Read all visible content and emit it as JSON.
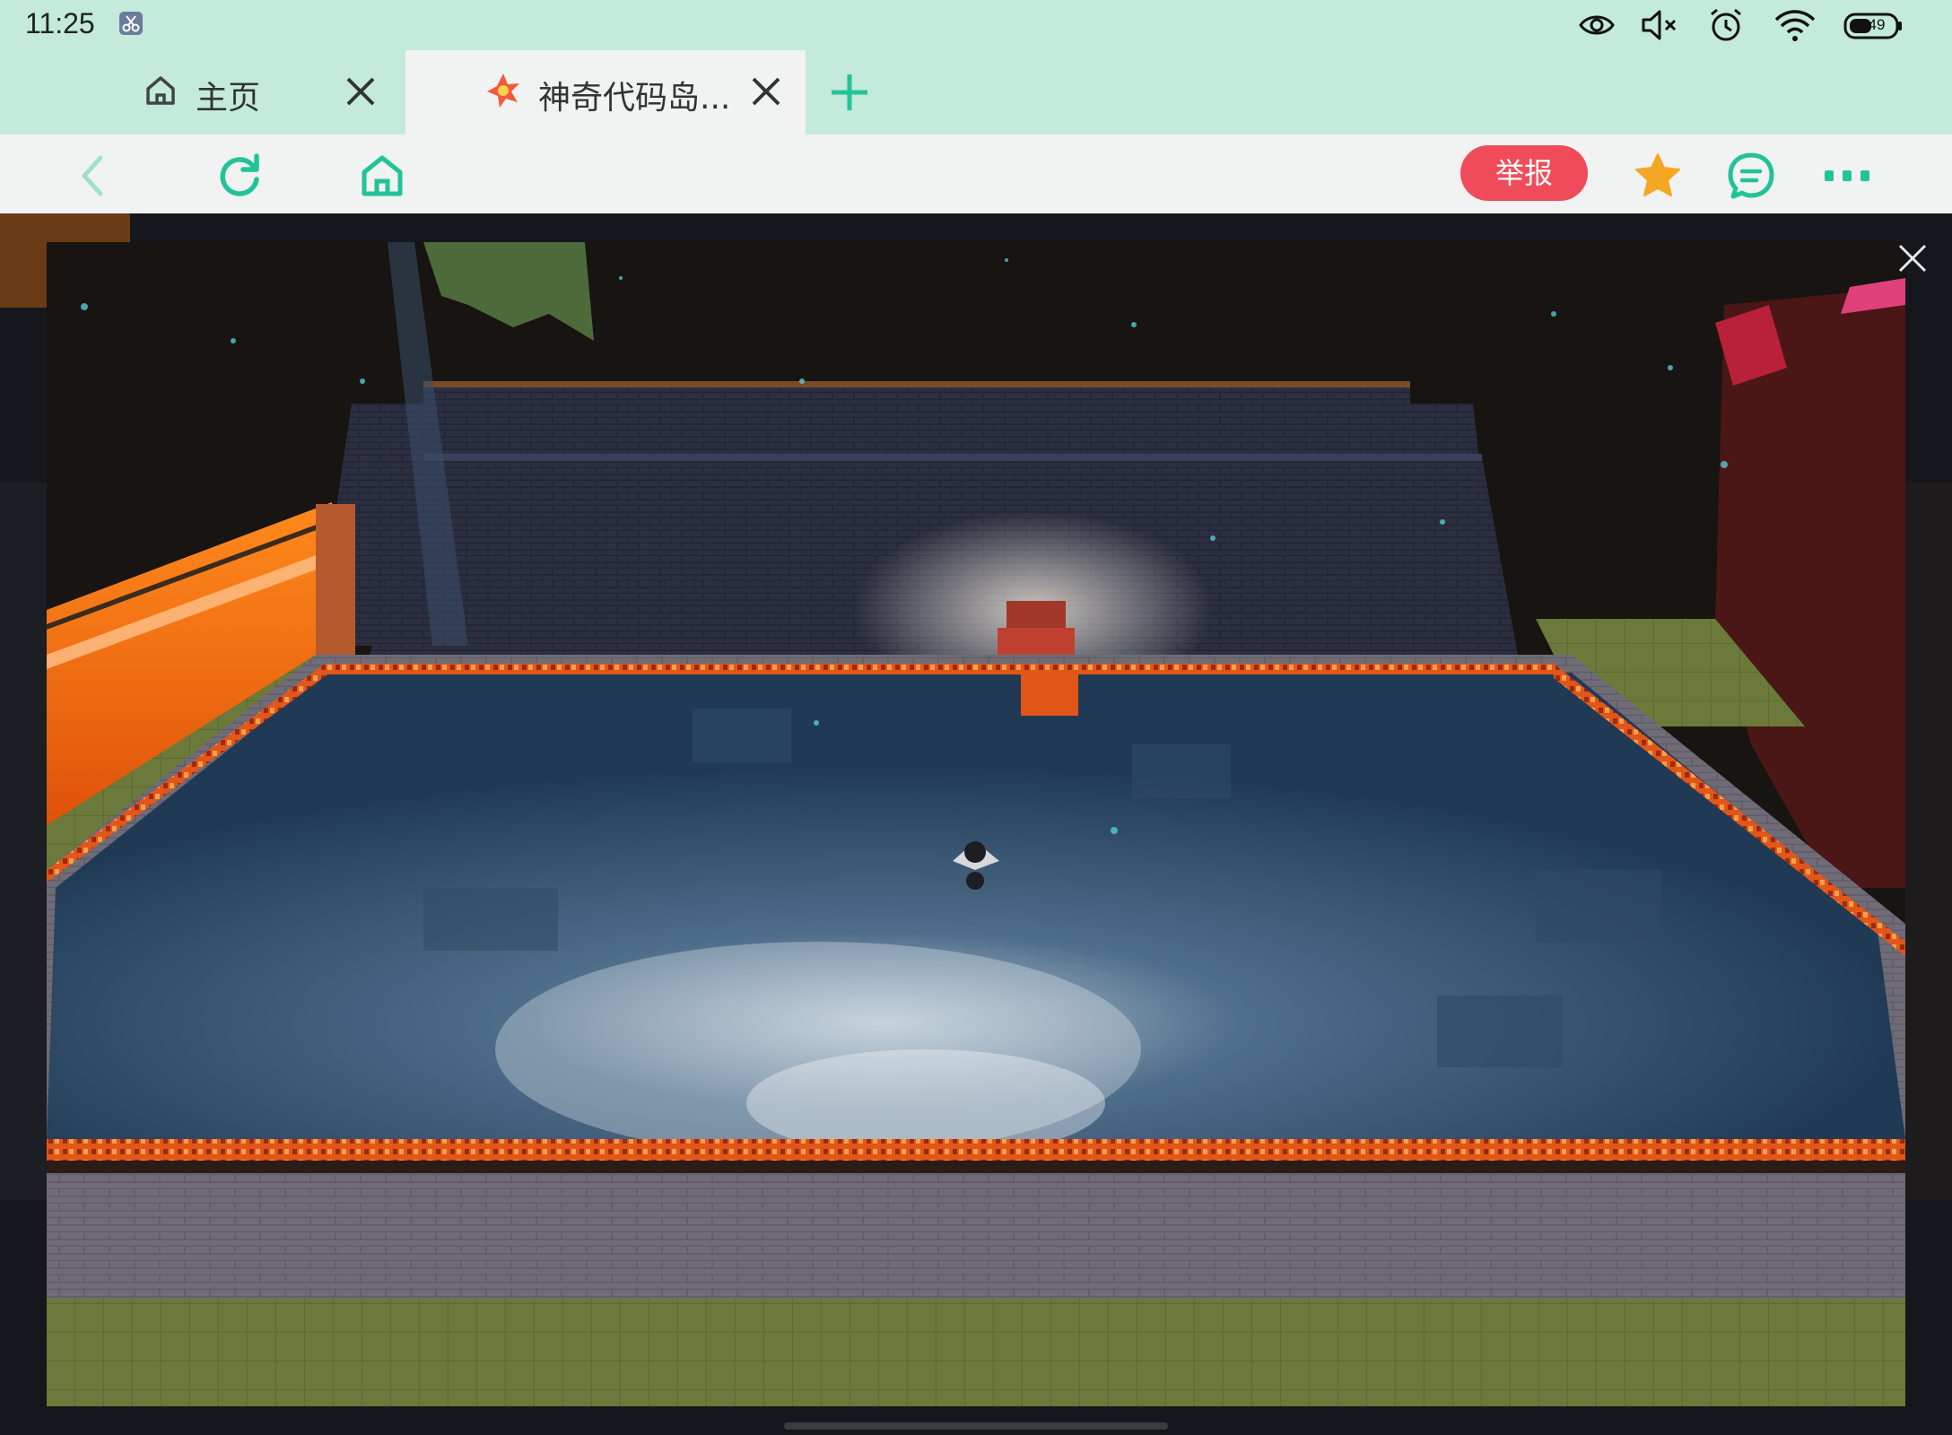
{
  "status_bar": {
    "time": "11:25",
    "clip_icon": "scissors-icon",
    "icons": [
      "eye-icon",
      "mute-icon",
      "alarm-icon",
      "wifi-icon",
      "battery-icon"
    ],
    "battery_level": "49"
  },
  "tabs": [
    {
      "title": "主页",
      "icon": "home-icon",
      "active": false
    },
    {
      "title": "神奇代码岛...",
      "icon": "codeisland-logo-icon",
      "active": true
    }
  ],
  "new_tab_icon": "plus-icon",
  "toolbar": {
    "back_icon": "back-arrow-icon",
    "refresh_icon": "refresh-icon",
    "home_icon": "home-icon",
    "report_label": "举报",
    "favorite_icon": "star-icon",
    "comment_icon": "comment-icon",
    "more_icon": "more-icon"
  },
  "colors": {
    "accent_green": "#22c39a",
    "status_bg": "#c3eadb",
    "toolbar_bg": "#f1f2f2",
    "report_red": "#f04b5a",
    "star_orange": "#f5a623"
  },
  "game": {
    "overlay_close_icon": "close-icon",
    "scene": "voxel-pool-night-scene"
  }
}
